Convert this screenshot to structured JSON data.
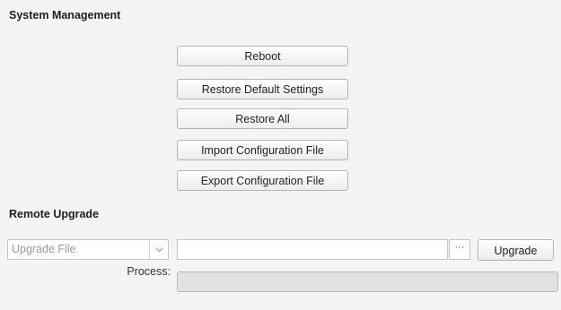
{
  "system_management": {
    "title": "System Management",
    "buttons": {
      "reboot": "Reboot",
      "restore_default": "Restore Default Settings",
      "restore_all": "Restore All",
      "import_config": "Import Configuration File",
      "export_config": "Export Configuration File"
    }
  },
  "remote_upgrade": {
    "title": "Remote Upgrade",
    "file_type_select": {
      "selected": "Upgrade File",
      "icon": "chevron-down-icon"
    },
    "file_path": {
      "value": "",
      "placeholder": ""
    },
    "browse_label": "···",
    "upgrade_label": "Upgrade",
    "process_label": "Process:",
    "progress": 0
  },
  "colors": {
    "panel_bg": "#f4f4f4",
    "progress_track": "#e1e1e1"
  }
}
